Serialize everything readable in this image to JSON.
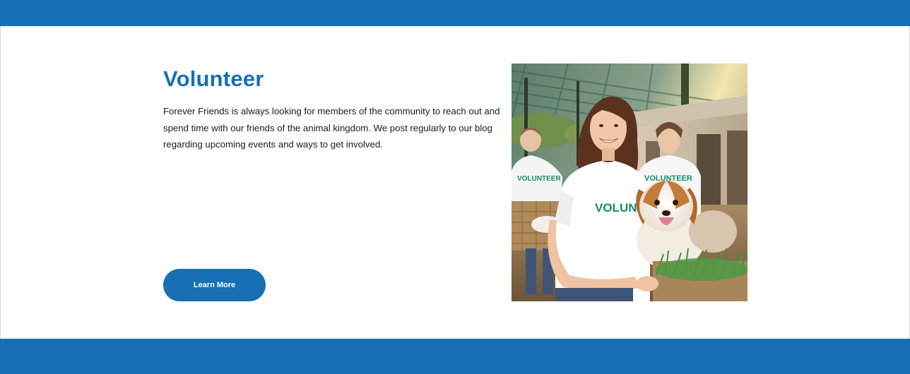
{
  "volunteer": {
    "title": "Volunteer",
    "body": "Forever Friends is always looking for members of the community to reach out and spend time with our friends of the animal kingdom. We post regularly to our blog regarding upcoming events and ways to get involved.",
    "button_label": "Learn More"
  },
  "photo": {
    "shirt_text": "VOLUNTEER"
  },
  "colors": {
    "brand_blue": "#1670b3",
    "body_text": "#1a1a1a",
    "background": "#ffffff"
  }
}
